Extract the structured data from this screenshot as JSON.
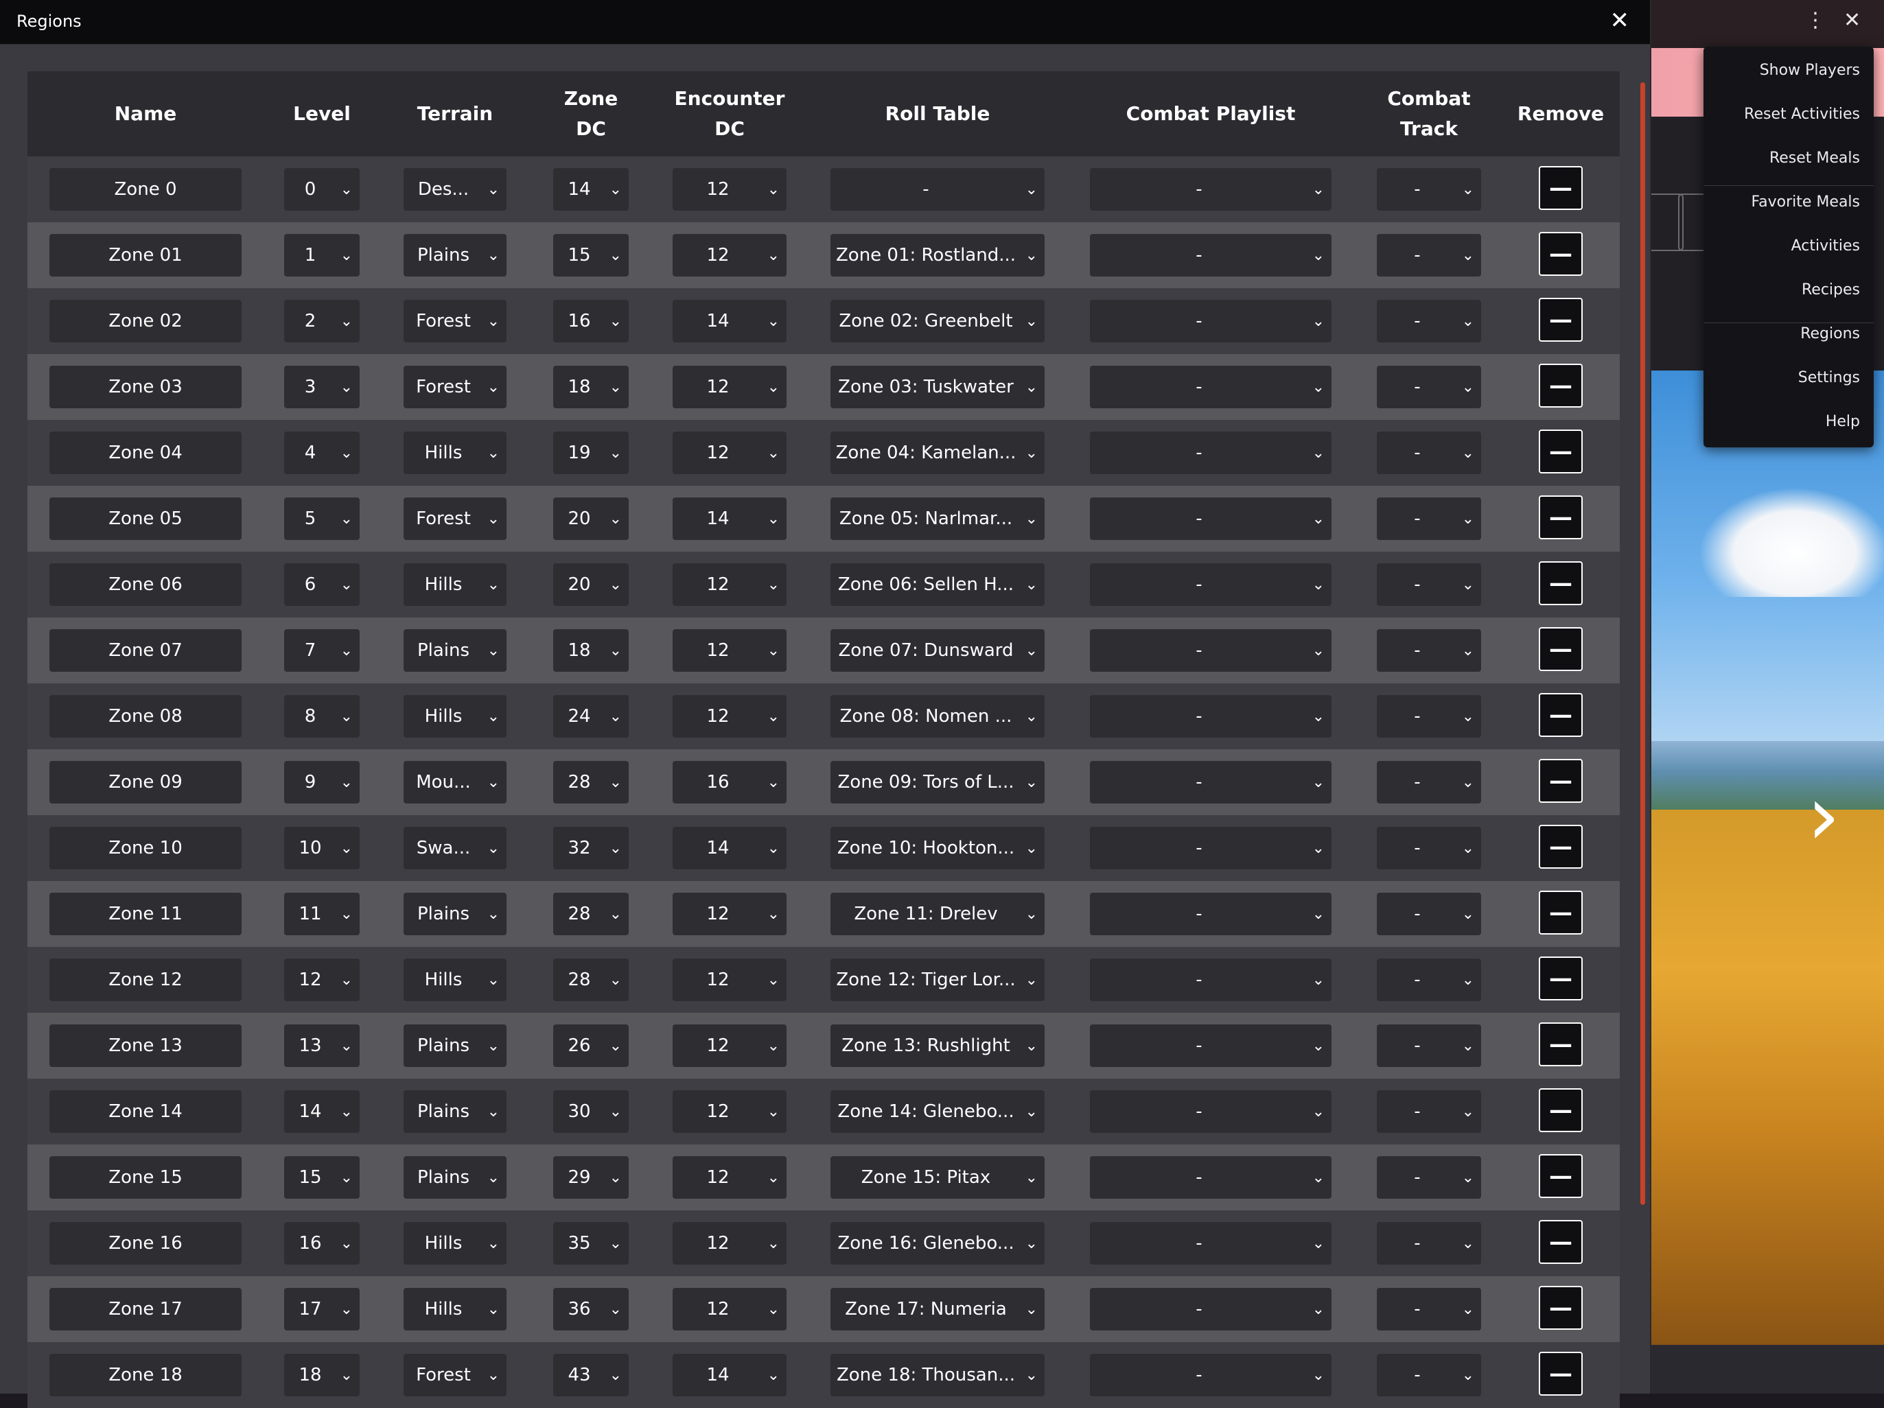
{
  "dialog": {
    "title": "Regions",
    "close_glyph": "✕"
  },
  "top_controls": {
    "kebab": "⋮",
    "close": "✕"
  },
  "menu": {
    "items": [
      "Show Players",
      "Reset Activities",
      "Reset Meals",
      "Favorite Meals",
      "Activities",
      "Recipes",
      "Regions",
      "Settings",
      "Help"
    ]
  },
  "table": {
    "headers": {
      "name": "Name",
      "level": "Level",
      "terrain": "Terrain",
      "zone_dc_1": "Zone",
      "zone_dc_2": "DC",
      "enc_dc_1": "Encounter",
      "enc_dc_2": "DC",
      "roll_table": "Roll Table",
      "combat_playlist": "Combat Playlist",
      "combat_track_1": "Combat",
      "combat_track_2": "Track",
      "remove": "Remove"
    },
    "rows": [
      {
        "name": "Zone 0",
        "level": "0",
        "terrain": "Des...",
        "zone_dc": "14",
        "enc_dc": "12",
        "roll_table": "-",
        "playlist": "-",
        "track": "-"
      },
      {
        "name": "Zone 01",
        "level": "1",
        "terrain": "Plains",
        "zone_dc": "15",
        "enc_dc": "12",
        "roll_table": "Zone 01: Rostland...",
        "playlist": "-",
        "track": "-"
      },
      {
        "name": "Zone 02",
        "level": "2",
        "terrain": "Forest",
        "zone_dc": "16",
        "enc_dc": "14",
        "roll_table": "Zone 02: Greenbelt",
        "playlist": "-",
        "track": "-"
      },
      {
        "name": "Zone 03",
        "level": "3",
        "terrain": "Forest",
        "zone_dc": "18",
        "enc_dc": "12",
        "roll_table": "Zone 03: Tuskwater",
        "playlist": "-",
        "track": "-"
      },
      {
        "name": "Zone 04",
        "level": "4",
        "terrain": "Hills",
        "zone_dc": "19",
        "enc_dc": "12",
        "roll_table": "Zone 04: Kamelan...",
        "playlist": "-",
        "track": "-"
      },
      {
        "name": "Zone 05",
        "level": "5",
        "terrain": "Forest",
        "zone_dc": "20",
        "enc_dc": "14",
        "roll_table": "Zone 05: Narlmar...",
        "playlist": "-",
        "track": "-"
      },
      {
        "name": "Zone 06",
        "level": "6",
        "terrain": "Hills",
        "zone_dc": "20",
        "enc_dc": "12",
        "roll_table": "Zone 06: Sellen H...",
        "playlist": "-",
        "track": "-"
      },
      {
        "name": "Zone 07",
        "level": "7",
        "terrain": "Plains",
        "zone_dc": "18",
        "enc_dc": "12",
        "roll_table": "Zone 07: Dunsward",
        "playlist": "-",
        "track": "-"
      },
      {
        "name": "Zone 08",
        "level": "8",
        "terrain": "Hills",
        "zone_dc": "24",
        "enc_dc": "12",
        "roll_table": "Zone 08: Nomen ...",
        "playlist": "-",
        "track": "-"
      },
      {
        "name": "Zone 09",
        "level": "9",
        "terrain": "Mou...",
        "zone_dc": "28",
        "enc_dc": "16",
        "roll_table": "Zone 09: Tors of L...",
        "playlist": "-",
        "track": "-"
      },
      {
        "name": "Zone 10",
        "level": "10",
        "terrain": "Swa...",
        "zone_dc": "32",
        "enc_dc": "14",
        "roll_table": "Zone 10: Hookton...",
        "playlist": "-",
        "track": "-"
      },
      {
        "name": "Zone 11",
        "level": "11",
        "terrain": "Plains",
        "zone_dc": "28",
        "enc_dc": "12",
        "roll_table": "Zone 11: Drelev",
        "playlist": "-",
        "track": "-"
      },
      {
        "name": "Zone 12",
        "level": "12",
        "terrain": "Hills",
        "zone_dc": "28",
        "enc_dc": "12",
        "roll_table": "Zone 12: Tiger Lor...",
        "playlist": "-",
        "track": "-"
      },
      {
        "name": "Zone 13",
        "level": "13",
        "terrain": "Plains",
        "zone_dc": "26",
        "enc_dc": "12",
        "roll_table": "Zone 13: Rushlight",
        "playlist": "-",
        "track": "-"
      },
      {
        "name": "Zone 14",
        "level": "14",
        "terrain": "Plains",
        "zone_dc": "30",
        "enc_dc": "12",
        "roll_table": "Zone 14: Glenebo...",
        "playlist": "-",
        "track": "-"
      },
      {
        "name": "Zone 15",
        "level": "15",
        "terrain": "Plains",
        "zone_dc": "29",
        "enc_dc": "12",
        "roll_table": "Zone 15: Pitax",
        "playlist": "-",
        "track": "-"
      },
      {
        "name": "Zone 16",
        "level": "16",
        "terrain": "Hills",
        "zone_dc": "35",
        "enc_dc": "12",
        "roll_table": "Zone 16: Glenebo...",
        "playlist": "-",
        "track": "-"
      },
      {
        "name": "Zone 17",
        "level": "17",
        "terrain": "Hills",
        "zone_dc": "36",
        "enc_dc": "12",
        "roll_table": "Zone 17: Numeria",
        "playlist": "-",
        "track": "-"
      },
      {
        "name": "Zone 18",
        "level": "18",
        "terrain": "Forest",
        "zone_dc": "43",
        "enc_dc": "14",
        "roll_table": "Zone 18: Thousan...",
        "playlist": "-",
        "track": "-"
      }
    ]
  },
  "glyphs": {
    "dropdown_arrow": "⌄",
    "remove": "—"
  }
}
